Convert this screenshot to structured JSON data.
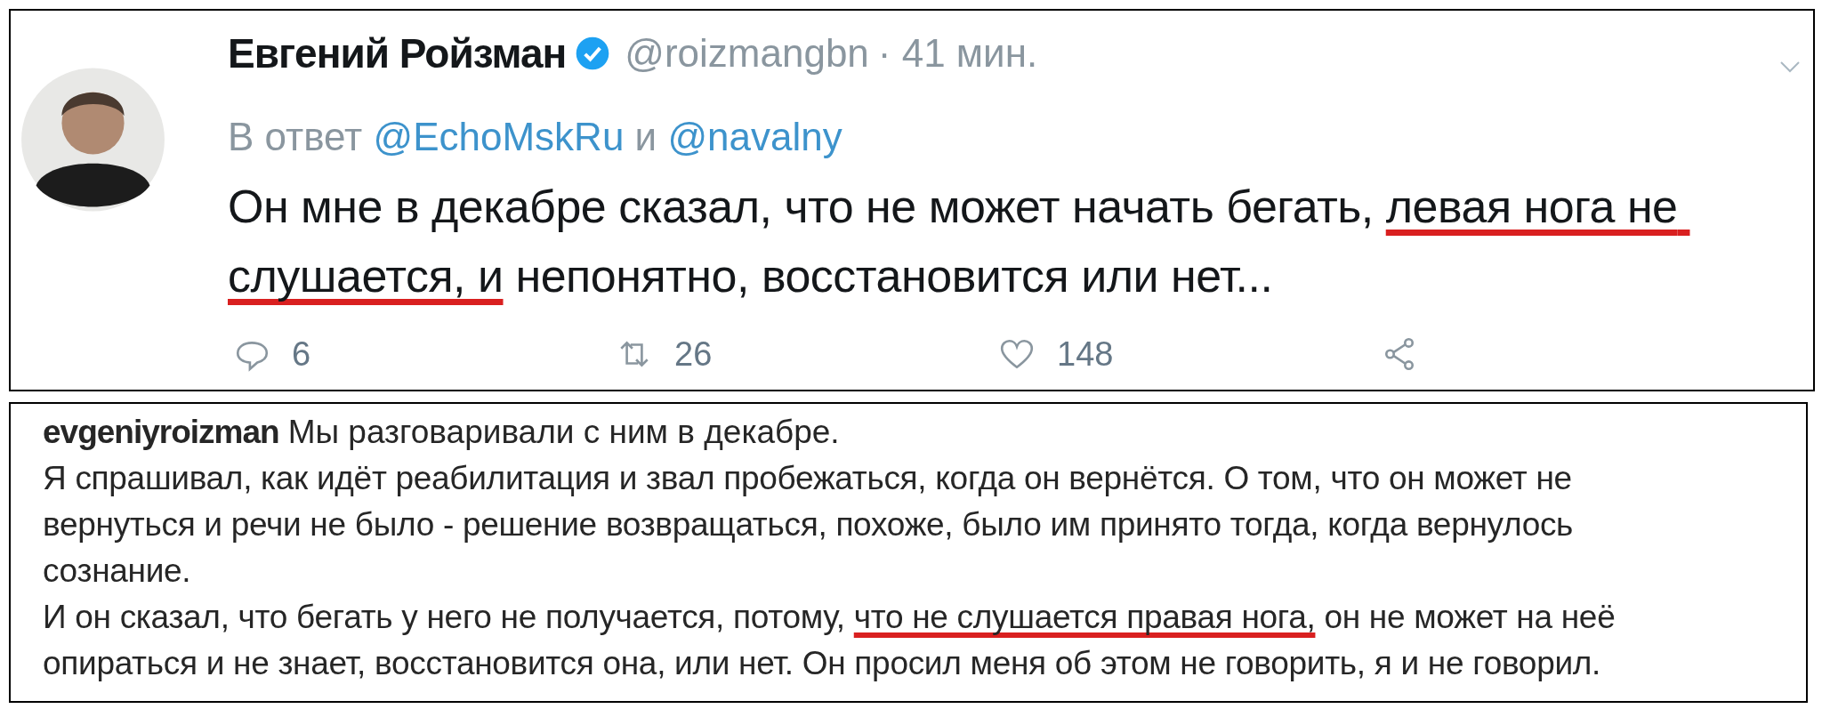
{
  "tweet": {
    "author": "Евгений Ройзман",
    "verified": true,
    "handle": "@roizmangbn",
    "time": "· 41 мин.",
    "reply": {
      "prefix": "В ответ",
      "mentions": [
        "@EchoMskRu",
        "@navalny"
      ],
      "joiner": "и"
    },
    "text": [
      {
        "text": "Он мне в декабре сказал, что не может начать бегать, ",
        "underlined": false
      },
      {
        "text": "левая нога не слушается, и",
        "underlined": true
      },
      {
        "text": " непонятно, восстановится или нет...",
        "underlined": false
      }
    ],
    "actions": [
      {
        "kind": "reply",
        "count": "6"
      },
      {
        "kind": "retweet",
        "count": "26"
      },
      {
        "kind": "like",
        "count": "148"
      },
      {
        "kind": "share"
      }
    ]
  },
  "comment": {
    "username": "evgeniyroizman",
    "text": "Мы разговаривали с ним в декабре.",
    "paragraphs": [
      [
        {
          "text": "Я спрашивал, как идёт реабилитация и звал пробежаться, когда он вернётся. О том, что он может не вернуться и речи не было - решение возвращаться, похоже, было им принято тогда, когда вернулось сознание.",
          "underlined": false
        }
      ],
      [
        {
          "text": "И он сказал, что бегать у него не получается, потому, ",
          "underlined": false
        },
        {
          "text": "что не слушается правая нога,",
          "underlined": true
        },
        {
          "text": " он не может на неё опираться и не знает, восстановится она, или нет. Он просил меня об этом не говорить, я и не говорил.",
          "underlined": false
        }
      ]
    ]
  }
}
